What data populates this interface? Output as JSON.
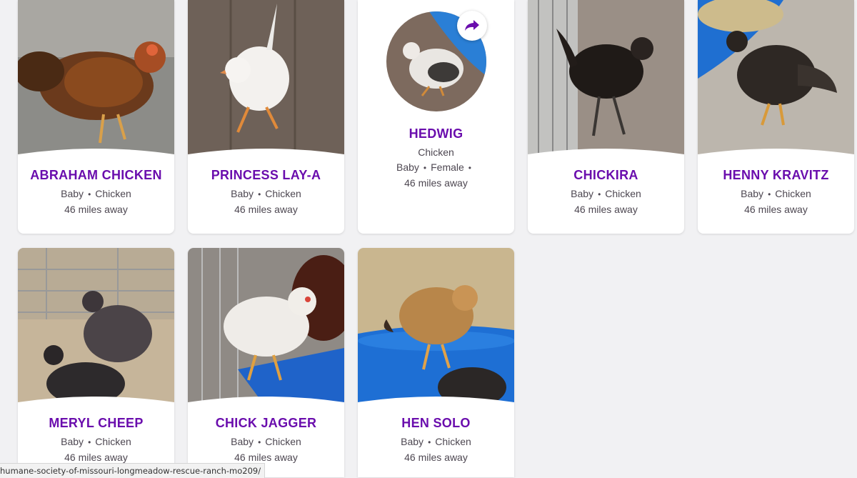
{
  "pets": [
    {
      "name": "ABRAHAM CHICKEN",
      "age": "Baby",
      "breed": "Chicken",
      "distance": "46 miles away"
    },
    {
      "name": "PRINCESS LAY-A",
      "age": "Baby",
      "breed": "Chicken",
      "distance": "46 miles away"
    },
    {
      "name": "HEDWIG",
      "breed": "Chicken",
      "age": "Baby",
      "gender": "Female",
      "distance": "46 miles away"
    },
    {
      "name": "CHICKIRA",
      "age": "Baby",
      "breed": "Chicken",
      "distance": "46 miles away"
    },
    {
      "name": "HENNY KRAVITZ",
      "age": "Baby",
      "breed": "Chicken",
      "distance": "46 miles away"
    },
    {
      "name": "MERYL CHEEP",
      "age": "Baby",
      "breed": "Chicken",
      "distance": "46 miles away"
    },
    {
      "name": "CHICK JAGGER",
      "age": "Baby",
      "breed": "Chicken",
      "distance": "46 miles away"
    },
    {
      "name": "HEN SOLO",
      "age": "Baby",
      "breed": "Chicken",
      "distance": "46 miles away"
    }
  ],
  "separator": "•",
  "status_url": "humane-society-of-missouri-longmeadow-rescue-ranch-mo209/",
  "colors": {
    "accent": "#6a0dad",
    "meta_text": "#4d4751",
    "background": "#f1f1f3"
  },
  "icons": {
    "share": "share-arrow-icon"
  }
}
